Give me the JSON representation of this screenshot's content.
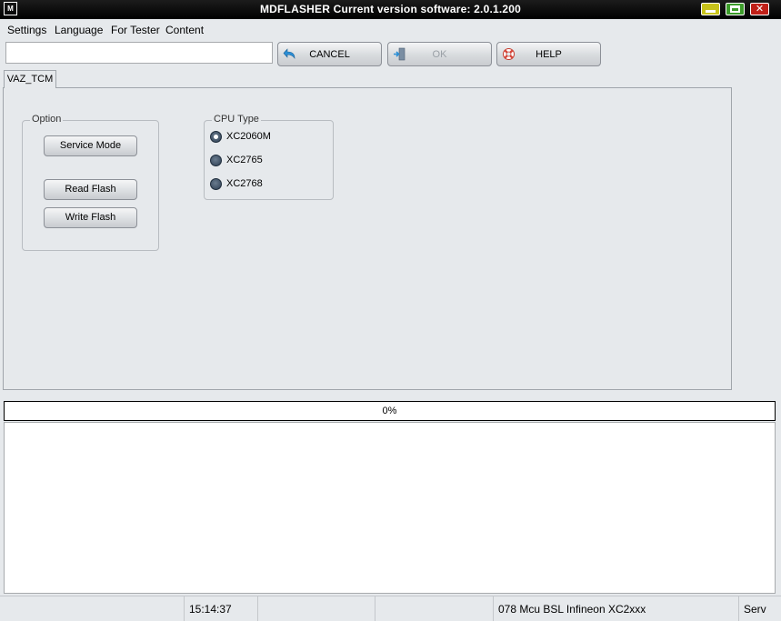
{
  "window": {
    "title": "MDFLASHER  Current version software: 2.0.1.200",
    "icon_text": "M"
  },
  "menu": {
    "items": [
      "Settings",
      "Language",
      "For Tester",
      "Content"
    ]
  },
  "toolbar": {
    "input_value": "",
    "cancel_label": "CANCEL",
    "ok_label": "OK",
    "help_label": "HELP"
  },
  "tabs": [
    {
      "label": "VAZ_TCM"
    }
  ],
  "option_group": {
    "title": "Option",
    "service_mode_label": "Service Mode",
    "read_flash_label": "Read Flash",
    "write_flash_label": "Write Flash"
  },
  "cpu_group": {
    "title": "CPU Type",
    "options": [
      {
        "label": "XC2060M",
        "checked": true
      },
      {
        "label": "XC2765",
        "checked": false
      },
      {
        "label": "XC2768",
        "checked": false
      }
    ]
  },
  "progress": {
    "value": 0,
    "text": "0%"
  },
  "log": {
    "text": ""
  },
  "statusbar": {
    "cells": [
      "",
      "15:14:37",
      "",
      "",
      "078 Mcu BSL Infineon XC2xxx",
      "Serv"
    ]
  },
  "icons": {
    "cancel": "undo-arrow-icon",
    "ok": "exit-door-icon",
    "help": "lifebuoy-icon"
  },
  "colors": {
    "titlebar": "#000000",
    "window_bg": "#e6e9ec",
    "minimize": "#c7c21a",
    "maximize": "#3c9c2a",
    "close": "#c02018"
  }
}
